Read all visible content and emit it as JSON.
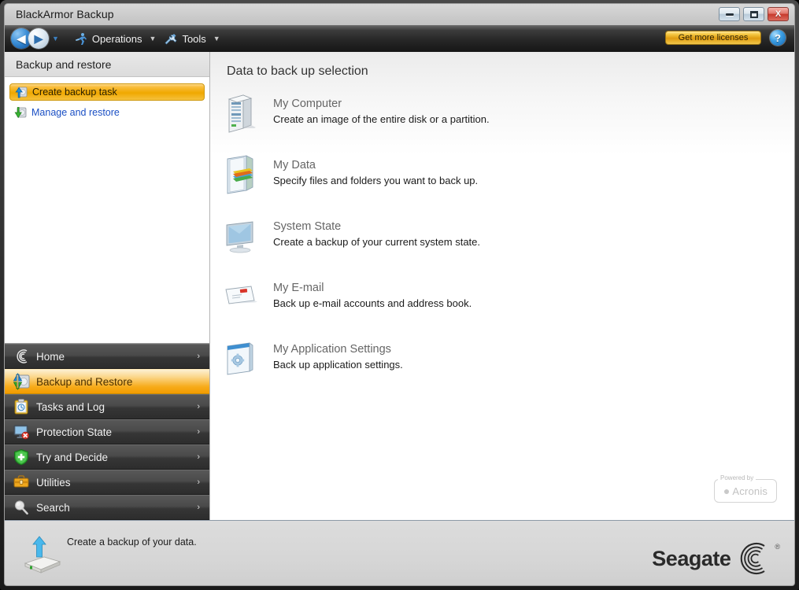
{
  "window": {
    "title": "BlackArmor Backup",
    "controls": [
      {
        "name": "minimize",
        "glyph": "minimize-icon"
      },
      {
        "name": "maximize",
        "glyph": "maximize-icon"
      },
      {
        "name": "close",
        "glyph": "close-icon",
        "label": "X"
      }
    ]
  },
  "toolbar": {
    "back_label": "◀",
    "forward_label": "▶",
    "history_caret": "▼",
    "items": [
      {
        "label": "Operations",
        "icon": "runner-icon",
        "caret": "▼"
      },
      {
        "label": "Tools",
        "icon": "tools-icon",
        "caret": "▼"
      }
    ],
    "licenses_label": "Get more licenses",
    "help_label": "?"
  },
  "sidebar": {
    "header": "Backup and restore",
    "links": [
      {
        "label": "Create backup task",
        "icon": "blue-up-arrow-disk-icon",
        "selected": true
      },
      {
        "label": "Manage and restore",
        "icon": "green-down-arrow-disk-icon",
        "selected": false
      }
    ],
    "nav": [
      {
        "label": "Home",
        "icon": "seagate-swirl-icon",
        "chevron": "›",
        "active": false
      },
      {
        "label": "Backup and Restore",
        "icon": "backup-restore-icon",
        "chevron": "",
        "active": true
      },
      {
        "label": "Tasks and Log",
        "icon": "clipboard-clock-icon",
        "chevron": "›",
        "active": false
      },
      {
        "label": "Protection State",
        "icon": "monitor-alert-icon",
        "chevron": "›",
        "active": false
      },
      {
        "label": "Try and Decide",
        "icon": "shield-plus-icon",
        "chevron": "›",
        "active": false
      },
      {
        "label": "Utilities",
        "icon": "toolbox-icon",
        "chevron": "›",
        "active": false
      },
      {
        "label": "Search",
        "icon": "magnifier-icon",
        "chevron": "›",
        "active": false
      }
    ]
  },
  "main": {
    "title": "Data to back up selection",
    "options": [
      {
        "name": "My Computer",
        "desc": "Create an image of the entire disk or a partition.",
        "icon": "tower-computer-icon"
      },
      {
        "name": "My Data",
        "desc": "Specify files and folders you want to back up.",
        "icon": "data-folder-icon"
      },
      {
        "name": "System State",
        "desc": "Create a backup of your current system state.",
        "icon": "monitor-icon"
      },
      {
        "name": "My E-mail",
        "desc": "Back up e-mail accounts and address book.",
        "icon": "envelope-icon"
      },
      {
        "name": "My Application Settings",
        "desc": "Back up application settings.",
        "icon": "app-settings-icon"
      }
    ],
    "acronis": {
      "powered_by": "Powered by",
      "name": "Acronis",
      "icon": "acronis-flame-icon"
    }
  },
  "statusbar": {
    "text": "Create a backup of your data.",
    "icon": "backup-drive-arrow-icon",
    "brand": {
      "wordmark": "Seagate",
      "registered": "®",
      "icon": "seagate-swirl-icon"
    }
  },
  "colors": {
    "accent_orange": "#f0a800",
    "link_blue": "#1a4fc4",
    "nav_dark": "#3a3a3a",
    "title_bar": "#d0d0d0"
  }
}
